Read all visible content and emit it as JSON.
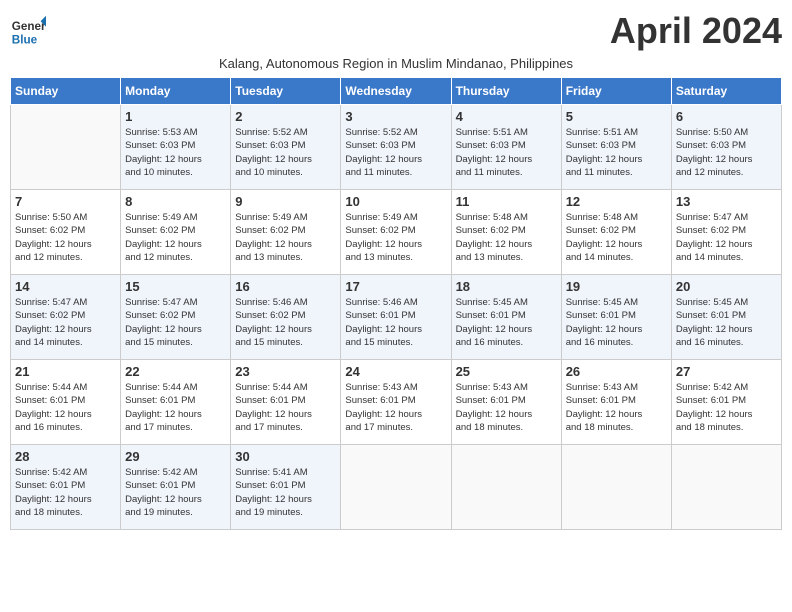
{
  "header": {
    "logo_line1": "General",
    "logo_line2": "Blue",
    "month_title": "April 2024",
    "subtitle": "Kalang, Autonomous Region in Muslim Mindanao, Philippines"
  },
  "calendar": {
    "days_of_week": [
      "Sunday",
      "Monday",
      "Tuesday",
      "Wednesday",
      "Thursday",
      "Friday",
      "Saturday"
    ],
    "weeks": [
      [
        {
          "day": "",
          "info": ""
        },
        {
          "day": "1",
          "info": "Sunrise: 5:53 AM\nSunset: 6:03 PM\nDaylight: 12 hours\nand 10 minutes."
        },
        {
          "day": "2",
          "info": "Sunrise: 5:52 AM\nSunset: 6:03 PM\nDaylight: 12 hours\nand 10 minutes."
        },
        {
          "day": "3",
          "info": "Sunrise: 5:52 AM\nSunset: 6:03 PM\nDaylight: 12 hours\nand 11 minutes."
        },
        {
          "day": "4",
          "info": "Sunrise: 5:51 AM\nSunset: 6:03 PM\nDaylight: 12 hours\nand 11 minutes."
        },
        {
          "day": "5",
          "info": "Sunrise: 5:51 AM\nSunset: 6:03 PM\nDaylight: 12 hours\nand 11 minutes."
        },
        {
          "day": "6",
          "info": "Sunrise: 5:50 AM\nSunset: 6:03 PM\nDaylight: 12 hours\nand 12 minutes."
        }
      ],
      [
        {
          "day": "7",
          "info": "Sunrise: 5:50 AM\nSunset: 6:02 PM\nDaylight: 12 hours\nand 12 minutes."
        },
        {
          "day": "8",
          "info": "Sunrise: 5:49 AM\nSunset: 6:02 PM\nDaylight: 12 hours\nand 12 minutes."
        },
        {
          "day": "9",
          "info": "Sunrise: 5:49 AM\nSunset: 6:02 PM\nDaylight: 12 hours\nand 13 minutes."
        },
        {
          "day": "10",
          "info": "Sunrise: 5:49 AM\nSunset: 6:02 PM\nDaylight: 12 hours\nand 13 minutes."
        },
        {
          "day": "11",
          "info": "Sunrise: 5:48 AM\nSunset: 6:02 PM\nDaylight: 12 hours\nand 13 minutes."
        },
        {
          "day": "12",
          "info": "Sunrise: 5:48 AM\nSunset: 6:02 PM\nDaylight: 12 hours\nand 14 minutes."
        },
        {
          "day": "13",
          "info": "Sunrise: 5:47 AM\nSunset: 6:02 PM\nDaylight: 12 hours\nand 14 minutes."
        }
      ],
      [
        {
          "day": "14",
          "info": "Sunrise: 5:47 AM\nSunset: 6:02 PM\nDaylight: 12 hours\nand 14 minutes."
        },
        {
          "day": "15",
          "info": "Sunrise: 5:47 AM\nSunset: 6:02 PM\nDaylight: 12 hours\nand 15 minutes."
        },
        {
          "day": "16",
          "info": "Sunrise: 5:46 AM\nSunset: 6:02 PM\nDaylight: 12 hours\nand 15 minutes."
        },
        {
          "day": "17",
          "info": "Sunrise: 5:46 AM\nSunset: 6:01 PM\nDaylight: 12 hours\nand 15 minutes."
        },
        {
          "day": "18",
          "info": "Sunrise: 5:45 AM\nSunset: 6:01 PM\nDaylight: 12 hours\nand 16 minutes."
        },
        {
          "day": "19",
          "info": "Sunrise: 5:45 AM\nSunset: 6:01 PM\nDaylight: 12 hours\nand 16 minutes."
        },
        {
          "day": "20",
          "info": "Sunrise: 5:45 AM\nSunset: 6:01 PM\nDaylight: 12 hours\nand 16 minutes."
        }
      ],
      [
        {
          "day": "21",
          "info": "Sunrise: 5:44 AM\nSunset: 6:01 PM\nDaylight: 12 hours\nand 16 minutes."
        },
        {
          "day": "22",
          "info": "Sunrise: 5:44 AM\nSunset: 6:01 PM\nDaylight: 12 hours\nand 17 minutes."
        },
        {
          "day": "23",
          "info": "Sunrise: 5:44 AM\nSunset: 6:01 PM\nDaylight: 12 hours\nand 17 minutes."
        },
        {
          "day": "24",
          "info": "Sunrise: 5:43 AM\nSunset: 6:01 PM\nDaylight: 12 hours\nand 17 minutes."
        },
        {
          "day": "25",
          "info": "Sunrise: 5:43 AM\nSunset: 6:01 PM\nDaylight: 12 hours\nand 18 minutes."
        },
        {
          "day": "26",
          "info": "Sunrise: 5:43 AM\nSunset: 6:01 PM\nDaylight: 12 hours\nand 18 minutes."
        },
        {
          "day": "27",
          "info": "Sunrise: 5:42 AM\nSunset: 6:01 PM\nDaylight: 12 hours\nand 18 minutes."
        }
      ],
      [
        {
          "day": "28",
          "info": "Sunrise: 5:42 AM\nSunset: 6:01 PM\nDaylight: 12 hours\nand 18 minutes."
        },
        {
          "day": "29",
          "info": "Sunrise: 5:42 AM\nSunset: 6:01 PM\nDaylight: 12 hours\nand 19 minutes."
        },
        {
          "day": "30",
          "info": "Sunrise: 5:41 AM\nSunset: 6:01 PM\nDaylight: 12 hours\nand 19 minutes."
        },
        {
          "day": "",
          "info": ""
        },
        {
          "day": "",
          "info": ""
        },
        {
          "day": "",
          "info": ""
        },
        {
          "day": "",
          "info": ""
        }
      ]
    ]
  }
}
